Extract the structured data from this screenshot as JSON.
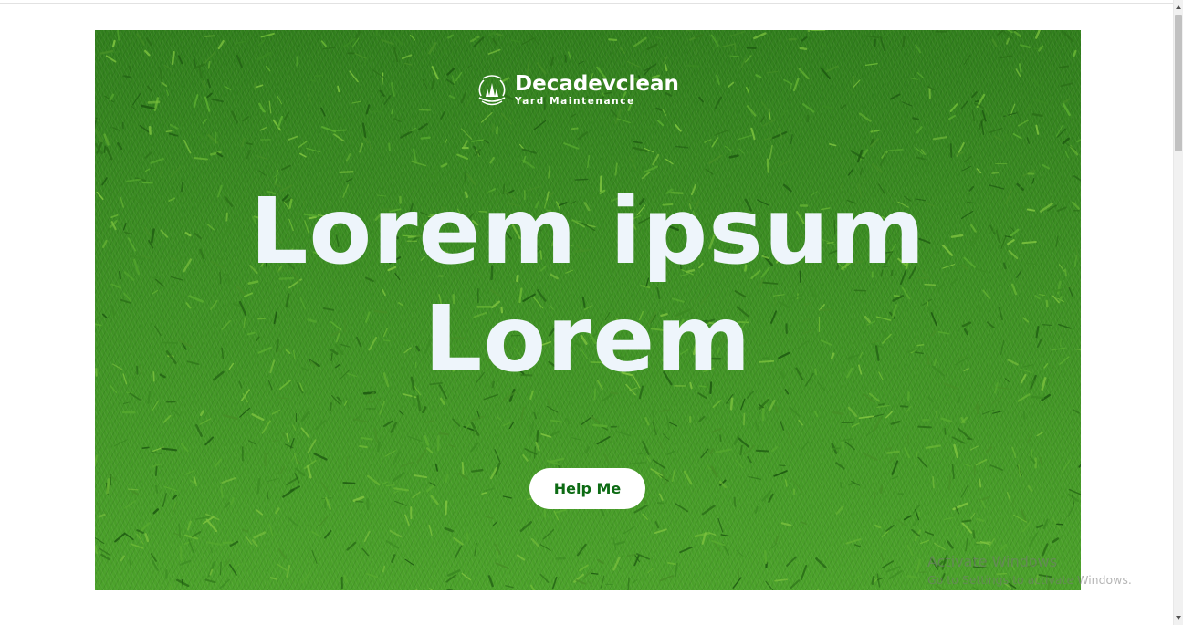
{
  "hero": {
    "brand": {
      "logo_icon": "leaf-badge-icon",
      "name": "Decadevclean",
      "tagline": "Yard Maintenance"
    },
    "headline_line1": "Lorem ipsum",
    "headline_line2": "Lorem",
    "cta_label": "Help Me"
  },
  "watermark": {
    "line1": "Activate Windows",
    "line2": "Go to Settings to activate Windows."
  },
  "colors": {
    "grass": "#3f8f22",
    "headline_text": "#eef5fb",
    "cta_text": "#0d6b14",
    "cta_bg": "#ffffff"
  }
}
